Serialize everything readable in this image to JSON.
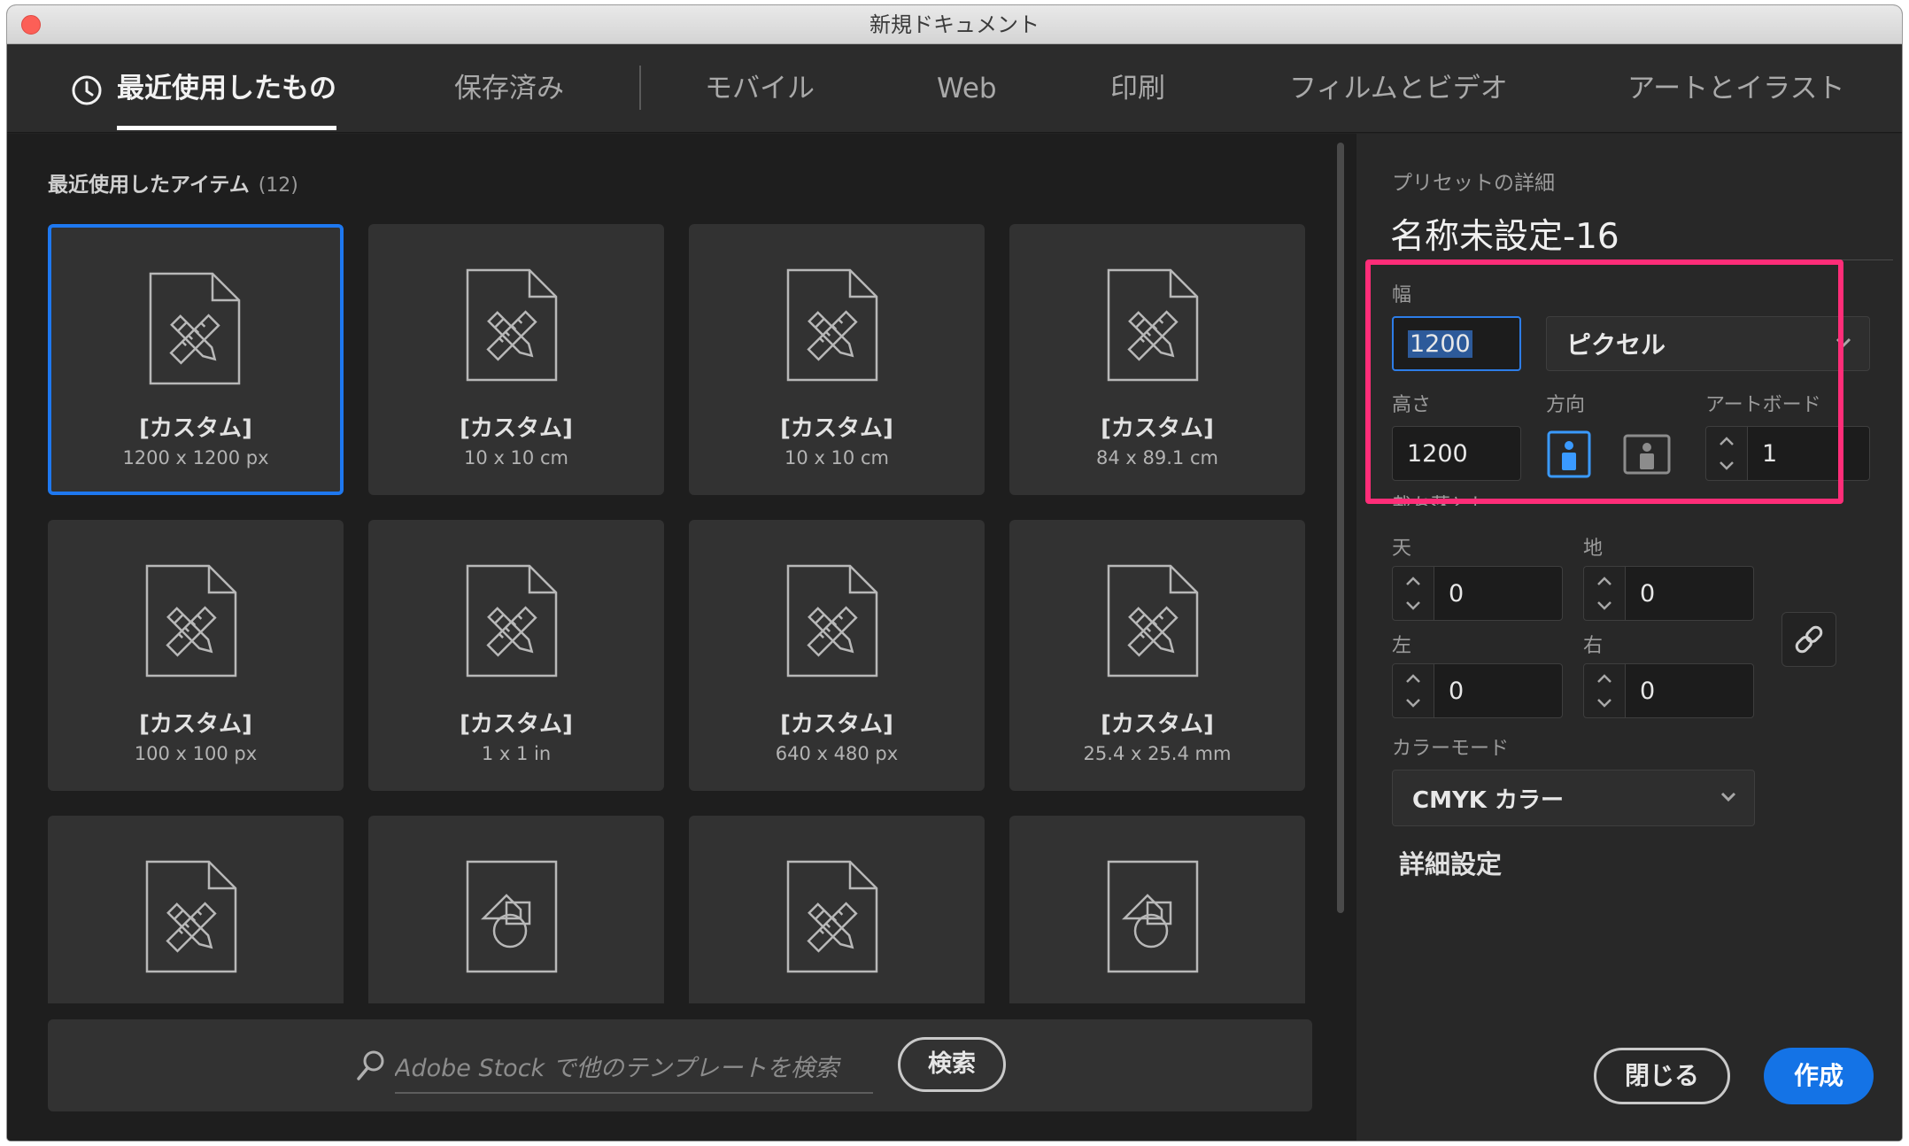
{
  "window": {
    "title": "新規ドキュメント"
  },
  "tabs": [
    {
      "label": "最近使用したもの",
      "active": true
    },
    {
      "label": "保存済み"
    },
    {
      "label": "モバイル"
    },
    {
      "label": "Web"
    },
    {
      "label": "印刷"
    },
    {
      "label": "フィルムとビデオ"
    },
    {
      "label": "アートとイラスト"
    }
  ],
  "recent": {
    "heading": "最近使用したアイテム",
    "count": "(12)",
    "items": [
      {
        "title": "[カスタム]",
        "size": "1200 x 1200 px",
        "icon": "custom-doc-icon",
        "selected": true
      },
      {
        "title": "[カスタム]",
        "size": "10 x 10 cm",
        "icon": "custom-doc-icon"
      },
      {
        "title": "[カスタム]",
        "size": "10 x 10 cm",
        "icon": "custom-doc-icon"
      },
      {
        "title": "[カスタム]",
        "size": "84 x 89.1 cm",
        "icon": "custom-doc-icon"
      },
      {
        "title": "[カスタム]",
        "size": "100 x 100 px",
        "icon": "custom-doc-icon"
      },
      {
        "title": "[カスタム]",
        "size": "1 x 1 in",
        "icon": "custom-doc-icon"
      },
      {
        "title": "[カスタム]",
        "size": "640 x 480 px",
        "icon": "custom-doc-icon"
      },
      {
        "title": "[カスタム]",
        "size": "25.4 x 25.4 mm",
        "icon": "custom-doc-icon"
      },
      {
        "icon": "custom-doc-icon"
      },
      {
        "icon": "shapes-doc-icon"
      },
      {
        "icon": "custom-doc-icon"
      },
      {
        "icon": "shapes-doc-icon"
      }
    ]
  },
  "stock": {
    "placeholder": "Adobe Stock で他のテンプレートを検索",
    "search_label": "検索"
  },
  "preset": {
    "heading": "プリセットの詳細",
    "name": "名称未設定-16",
    "width_label": "幅",
    "width_value": "1200",
    "unit": "ピクセル",
    "height_label": "高さ",
    "height_value": "1200",
    "orientation_label": "方向",
    "artboard_label": "アートボード",
    "artboard_value": "1",
    "bleed_label": "裁ち落とし",
    "top_label": "天",
    "top_value": "0",
    "bottom_label": "地",
    "bottom_value": "0",
    "left_label": "左",
    "left_value": "0",
    "right_label": "右",
    "right_value": "0",
    "color_mode_label": "カラーモード",
    "color_mode_value": "CMYK カラー",
    "advanced_label": "詳細設定"
  },
  "buttons": {
    "close": "閉じる",
    "create": "作成"
  },
  "colors": {
    "accent": "#1473e6",
    "highlight": "#ff2d78",
    "selected_border": "#1e78f0"
  }
}
